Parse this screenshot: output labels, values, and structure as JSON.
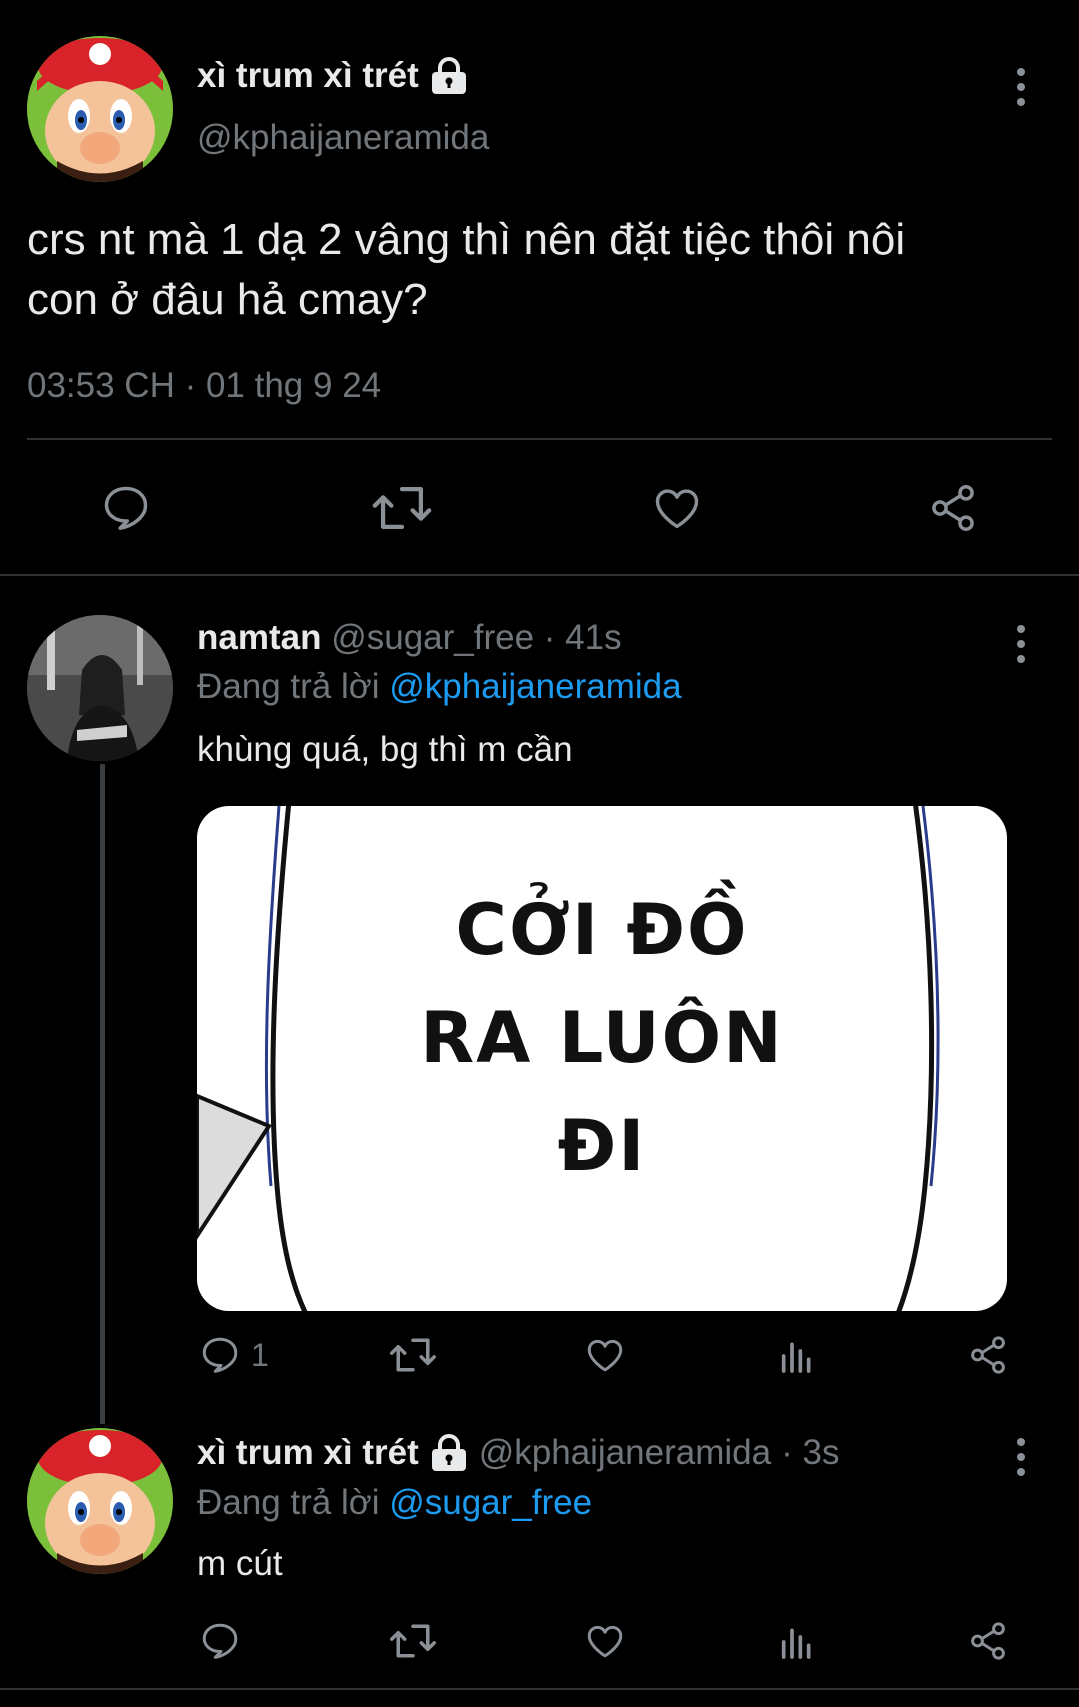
{
  "main_tweet": {
    "display_name": "xì trum xì trét",
    "handle": "@kphaijaneramida",
    "text_line1": "crs nt mà 1 dạ 2 vâng thì nên đặt tiệc thôi nôi",
    "text_line2": "con ở đâu hả cmay?",
    "timestamp": "03:53 CH · 01 thg 9 24",
    "icons": [
      "reply-icon",
      "retweet-icon",
      "like-icon",
      "share-icon"
    ]
  },
  "reply1": {
    "display_name": "namtan",
    "handle": "@sugar_free",
    "time": "· 41s",
    "replying_prefix": "Đang trả lời",
    "replying_to": "@kphaijaneramida",
    "text": "khùng quá, bg thì m cần",
    "media_lines": [
      "CỞI ĐỒ",
      "RA LUÔN",
      "ĐI"
    ],
    "reply_count": "1",
    "icons": [
      "reply-icon",
      "retweet-icon",
      "like-icon",
      "views-icon",
      "share-icon"
    ]
  },
  "reply2": {
    "display_name": "xì trum xì trét",
    "handle": "@kphaijaneramida",
    "time": "· 3s",
    "replying_prefix": "Đang trả lời",
    "replying_to": "@sugar_free",
    "text": "m cút",
    "icons": [
      "reply-icon",
      "retweet-icon",
      "like-icon",
      "views-icon",
      "share-icon"
    ]
  },
  "colors": {
    "background": "#000000",
    "text": "#e7e9ea",
    "muted": "#71767b",
    "link": "#1d9bf0",
    "divider": "#2f3336"
  }
}
